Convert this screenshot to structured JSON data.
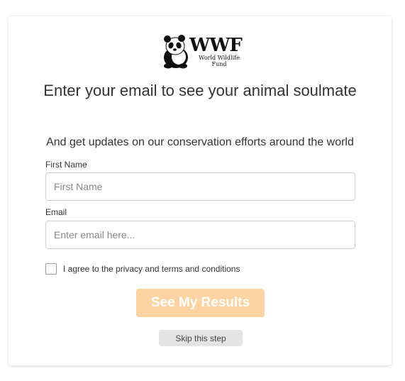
{
  "logo": {
    "brand": "WWF",
    "subtitle": "World Wildlife Fund",
    "icon": "panda-icon"
  },
  "title": "Enter your email to see your animal soulmate",
  "subtitle": "And get updates on our conservation efforts around the world",
  "form": {
    "first_name_label": "First Name",
    "first_name_placeholder": "First Name",
    "first_name_value": "",
    "email_label": "Email",
    "email_placeholder": "Enter email here...",
    "email_value": "",
    "agree_label": "I agree to the privacy and terms and conditions",
    "agree_checked": false,
    "submit_label": "See My Results",
    "skip_label": "Skip this step"
  },
  "colors": {
    "cta_background": "#fdd3a2",
    "skip_background": "#e4e4e4"
  }
}
